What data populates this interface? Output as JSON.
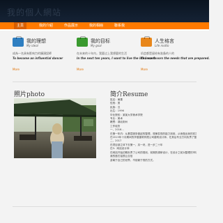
{
  "header": {
    "title": "我的個人網站"
  },
  "nav": {
    "items": [
      {
        "label": "主頁"
      },
      {
        "label": "我的介紹"
      },
      {
        "label": "作品展示"
      },
      {
        "label": "我的相冊"
      },
      {
        "label": "聯系我"
      }
    ]
  },
  "features": [
    {
      "title": "我的理想",
      "subtitle": "My ideal",
      "line1": "成為一名具有影响力的擴頭設師",
      "line2": "To become an influential dancer",
      "more": "More",
      "icon": "briefcase-icon",
      "color": "#2f7fc1"
    },
    {
      "title": "我的目标",
      "subtitle": "My goal",
      "line1": "在未来的十年内，我要过上我想要的生活",
      "line2": "In the next ten years, I want to live the life I want",
      "more": "More",
      "icon": "briefcase-icon",
      "color": "#3a9a2f"
    },
    {
      "title": "人生格言",
      "subtitle": "Life motto",
      "line1": "机会都是留给有准备的人的",
      "line2": "Chance favors the needs that are prepared.",
      "more": "More",
      "icon": "briefcase-icon",
      "color": "#e8861a"
    }
  ],
  "photo": {
    "title": "照片photo"
  },
  "resume": {
    "title": "简介Resume",
    "lines": [
      "姓名：黄果",
      "性别：男",
      "民族：汉",
      "出生：1996",
      "毕业院校：某某大学美术学院",
      "专业：美术",
      "籍贯：湖北荆州",
      "工作经历",
      "一、2016...",
      "在第一年内：从基层服务做起的整理，规律发现的能力到用，从而做出我的初次自己：而独立",
      "在2015年十月期间的学做建筑有限公司建筑设计师，在其后专业方向负责了整体项目及主展板的材料工作，在后从这个基础上完成的项目就同时设计",
      "二、2017",
      "在项目部立体下去第一、另一块，进一步二十年",
      "在5：网站设计师",
      "在网站开始初期负责了公司的规划、前期的调研设计，在设计之前对整理的市场进行调研，做好网站的规划内容，完成了整个公司网站的设计工作",
      "我的座右铭很让自信",
      "游离于自己的世界，不依赖于别的方式。"
    ]
  },
  "colors": {
    "accent": "#ff7a00",
    "header_bg": "#0f1b2b"
  }
}
